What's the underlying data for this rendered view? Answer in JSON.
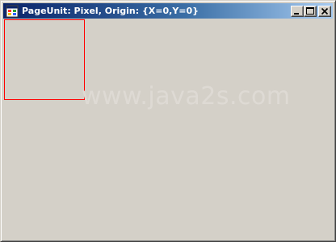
{
  "window": {
    "title": "PageUnit: Pixel, Origin: {X=0,Y=0}",
    "icon": "app-form-icon",
    "caption_buttons": [
      "minimize-icon",
      "maximize-icon",
      "close-icon"
    ]
  },
  "client": {
    "background_color": "#d4d0c8",
    "rectangle_color": "#ff0000",
    "watermark": "www.java2s.com"
  }
}
